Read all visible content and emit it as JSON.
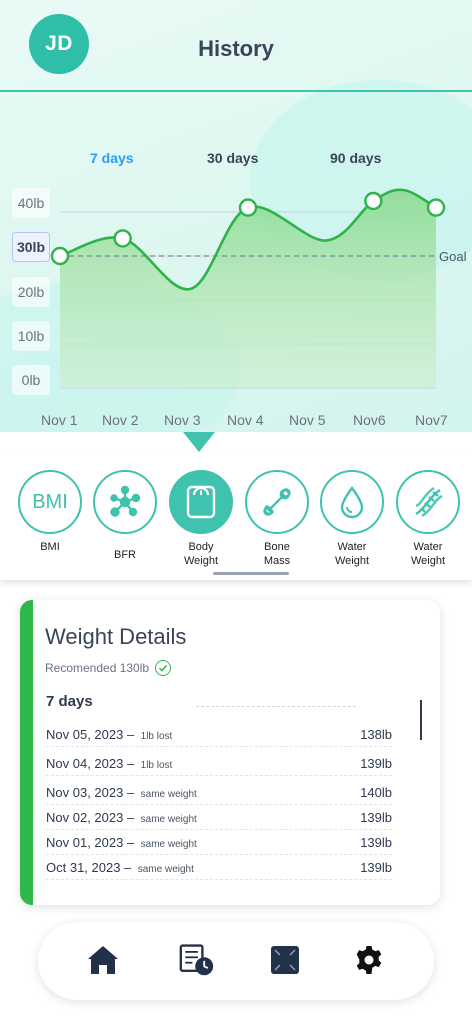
{
  "header": {
    "avatar_initials": "JD",
    "title": "History"
  },
  "ranges": [
    {
      "label": "7 days",
      "active": true
    },
    {
      "label": "30 days",
      "active": false
    },
    {
      "label": "90 days",
      "active": false
    }
  ],
  "chart_data": {
    "type": "area",
    "x": [
      "Nov 1",
      "Nov 2",
      "Nov 3",
      "Nov 4",
      "Nov 5",
      "Nov6",
      "Nov7"
    ],
    "y_ticks": [
      "40lb",
      "30lb",
      "20lb",
      "10lb",
      "0lb"
    ],
    "selected_tick": "30lb",
    "marker_values": [
      {
        "x": "Nov 1",
        "y": 30
      },
      {
        "x": "Nov 2",
        "y": 34
      },
      {
        "x": "Nov 4",
        "y": 41
      },
      {
        "x": "Nov6",
        "y": 42.5
      },
      {
        "x": "Nov7",
        "y": 41
      }
    ],
    "goal_label": "Goal",
    "goal_value": 30,
    "ylim": [
      0,
      40
    ],
    "colors": {
      "line": "#2db34a",
      "fill": "#8fdc97",
      "goal": "#7b8794"
    }
  },
  "metrics": [
    {
      "label": "BMI",
      "icon": "bmi-text-icon",
      "active": false
    },
    {
      "label": "BFR",
      "icon": "molecule-icon",
      "active": false
    },
    {
      "label": "Body\nWeight",
      "icon": "scale-icon",
      "active": true
    },
    {
      "label": "Bone\nMass",
      "icon": "bone-icon",
      "active": false
    },
    {
      "label": "Water\nWeight",
      "icon": "water-drop-icon",
      "active": false
    },
    {
      "label": "Water\nWeight",
      "icon": "dna-icon",
      "active": false
    }
  ],
  "bmi_icon_text": "BMI",
  "details": {
    "title": "Weight Details",
    "recommended": "Recomended 130lb",
    "period": "7 days",
    "rows": [
      {
        "date": "Nov 05, 2023 –",
        "note": "1lb lost",
        "value": "138lb"
      },
      {
        "date": "Nov 04, 2023 –",
        "note": "1lb lost",
        "value": "139lb"
      },
      {
        "date": "Nov 03, 2023 –",
        "note": "same weight",
        "value": "140lb"
      },
      {
        "date": "Nov 02, 2023 –",
        "note": "same weight",
        "value": "139lb"
      },
      {
        "date": "Nov 01, 2023 –",
        "note": "same weight",
        "value": "139lb"
      },
      {
        "date": "Oct 31, 2023 –",
        "note": "same weight",
        "value": "139lb"
      }
    ]
  },
  "nav": [
    {
      "icon": "home-icon"
    },
    {
      "icon": "history-icon"
    },
    {
      "icon": "scale-device-icon"
    },
    {
      "icon": "gear-icon"
    }
  ],
  "accent": "#3fc2ae"
}
